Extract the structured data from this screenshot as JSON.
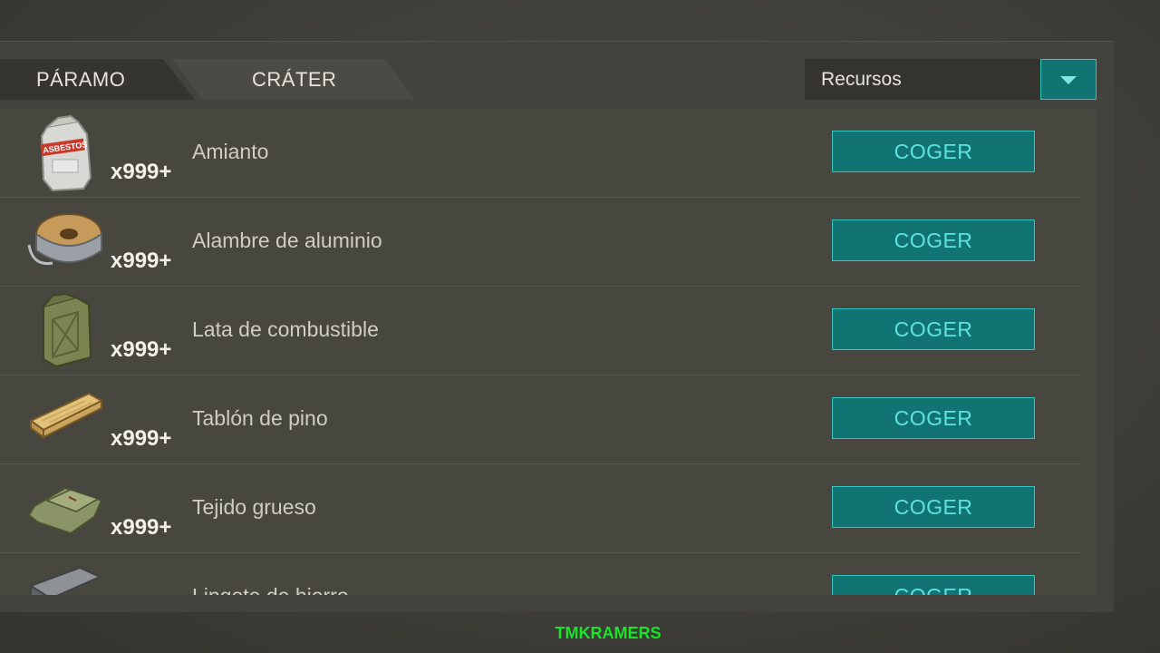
{
  "tabs": [
    {
      "label": "PÁRAMO"
    },
    {
      "label": "CRÁTER"
    }
  ],
  "filter": {
    "selected": "Recursos"
  },
  "items": [
    {
      "name": "Amianto",
      "qty": "x999+",
      "icon": "asbestos-bag-icon",
      "action": "COGER"
    },
    {
      "name": "Alambre de aluminio",
      "qty": "x999+",
      "icon": "wire-spool-icon",
      "action": "COGER"
    },
    {
      "name": "Lata de combustible",
      "qty": "x999+",
      "icon": "jerry-can-icon",
      "action": "COGER"
    },
    {
      "name": "Tablón de pino",
      "qty": "x999+",
      "icon": "wood-plank-icon",
      "action": "COGER"
    },
    {
      "name": "Tejido grueso",
      "qty": "x999+",
      "icon": "cloth-icon",
      "action": "COGER"
    },
    {
      "name": "Lingote de hierro",
      "qty": "",
      "icon": "iron-ingot-icon",
      "action": "COGER"
    }
  ],
  "icon_labels": {
    "asbestos_bag": "ASBESTOS"
  },
  "watermark": "TMKRAMERS",
  "colors": {
    "accent": "#127472",
    "accent_border": "#33c6c0",
    "button_text": "#5ee3dc"
  }
}
